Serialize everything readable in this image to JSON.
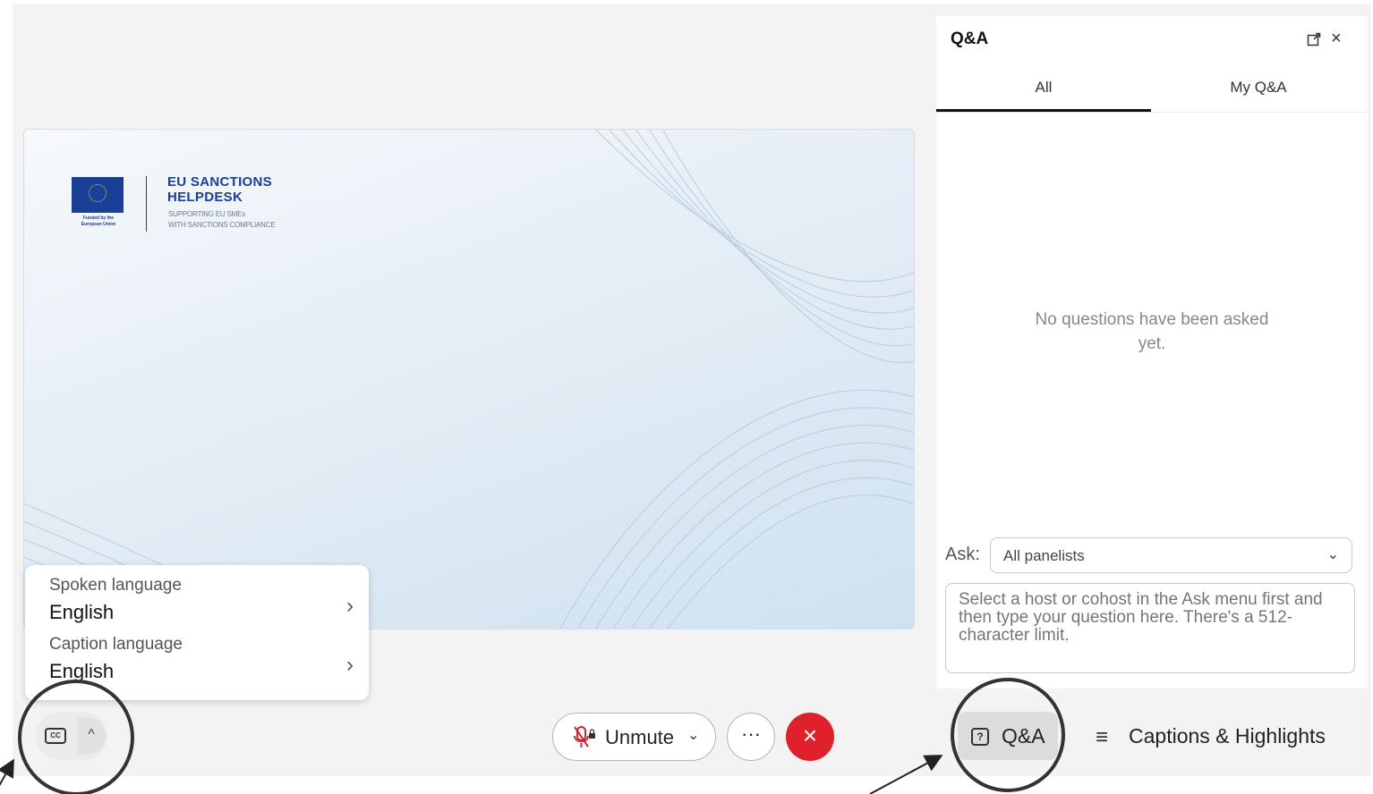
{
  "slide": {
    "logo_title_line1": "EU SANCTIONS",
    "logo_title_line2": "HELPDESK",
    "logo_sub_line1": "SUPPORTING EU SMEs",
    "logo_sub_line2": "WITH SANCTIONS COMPLIANCE",
    "funded_line1": "Funded by the",
    "funded_line2": "European Union"
  },
  "language_popup": {
    "spoken_label": "Spoken language",
    "spoken_value": "English",
    "caption_label": "Caption language",
    "caption_value": "English",
    "chevron_icon": "chevron-right-icon"
  },
  "bottom_bar": {
    "cc_icon": "closed-captions-icon",
    "cc_icon_text": "CC",
    "caret": "^",
    "unmute_label": "Unmute",
    "more_label": "···",
    "leave_label": "×",
    "qa_label": "Q&A",
    "qa_icon_text": "?",
    "captions_label": "Captions & Highlights",
    "captions_icon": "≡"
  },
  "qa_panel": {
    "title": "Q&A",
    "tabs": [
      {
        "label": "All",
        "active": true
      },
      {
        "label": "My Q&A",
        "active": false
      }
    ],
    "empty_message": "No questions have been asked yet.",
    "ask_label": "Ask:",
    "ask_value": "All panelists",
    "question_placeholder": "Select a host or cohost in the Ask menu first and then type your question here. There's a 512-character limit."
  },
  "colors": {
    "accent_eu_blue": "#1a3f96",
    "leave_red": "#e0212c",
    "mic_red": "#d0262f"
  }
}
